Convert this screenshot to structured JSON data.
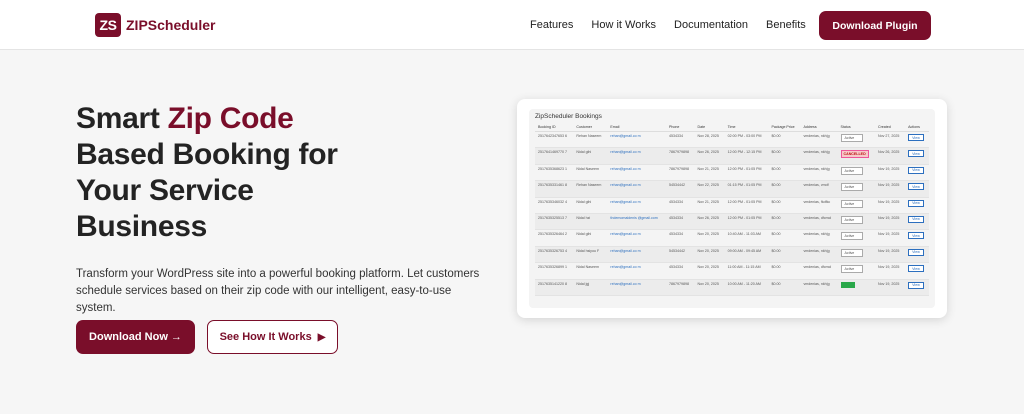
{
  "header": {
    "logo_mark": "ZS",
    "logo_text": "ZIPScheduler",
    "nav": [
      "Features",
      "How it Works",
      "Documentation",
      "Benefits"
    ],
    "cta": "Download Plugin"
  },
  "hero": {
    "title_l1a": "Smart ",
    "title_l1b": "Zip Code",
    "title_l2": "Based Booking for",
    "title_l3": "Your Service",
    "title_l4": "Business",
    "description": "Transform your WordPress site into a powerful booking platform. Let customers schedule services based on their zip code with our intelligent, easy-to-use system.",
    "btn_primary": "Download Now →",
    "btn_secondary": "See How It Works",
    "btn_secondary_icon": "▶"
  },
  "bookings": {
    "title": "ZipScheduler Bookings",
    "columns": [
      "Booking ID",
      "Customer",
      "Email",
      "Phone",
      "Date",
      "Time",
      "Package Price",
      "Address",
      "Status",
      "Created",
      "Actions"
    ],
    "rows": [
      [
        "2517642347653 6",
        "Rehan Naseem",
        "rehan@gmail.co m",
        "4534334",
        "Nov 28, 2025",
        "02:00 PM - 03:00 PM",
        "$0.00",
        "vmdenias, nkh|g",
        "Active",
        "Nov 27, 2025",
        "View"
      ],
      [
        "2517641469770 7",
        "Nidal gihi",
        "rehan@gmail.co m",
        "7867979898",
        "Nov 26, 2025",
        "12:00 PM - 12:15 PM",
        "$0.00",
        "vmdenias, nkh|g",
        "CANCELLED",
        "Nov 26, 2025",
        "View"
      ],
      [
        "2517635368623 1",
        "Nidal Naseem",
        "rehan@gmail.co m",
        "7867979898",
        "Nov 21, 2025",
        "12:00 PM - 01:05 PM",
        "$0.00",
        "vmdenias, nkh|g",
        "Active",
        "Nov 19, 2025",
        "View"
      ],
      [
        "2517635331461 8",
        "Rehan Naseem",
        "rehan@gmail.co m",
        "54534442",
        "Nov 22, 2025",
        "01:15 PM - 01:05 PM",
        "$0.00",
        "vmdenias, vmdf",
        "Active",
        "Nov 19, 2025",
        "View"
      ],
      [
        "2517635346032 4",
        "Nidal gihi",
        "rehan@gmail.co m",
        "4534334",
        "Nov 21, 2025",
        "12:00 PM - 01:05 PM",
        "$0.00",
        "vmdenias, fkdfkc",
        "Active",
        "Nov 19, 2025",
        "View"
      ],
      [
        "2517635325513 7",
        "Nidal hzi",
        "thdemomaidenis @gmail.com",
        "4534334",
        "Nov 26, 2025",
        "12:00 PM - 01:05 PM",
        "$0.00",
        "vmdenias, dfcmcl",
        "Active",
        "Nov 19, 2025",
        "View"
      ],
      [
        "2517635326464 2",
        "Nidal gihi",
        "rehan@gmail.co m",
        "4534334",
        "Nov 20, 2025",
        "10:40 AM - 11:03 AM",
        "$0.00",
        "vmdenias, nkh|g",
        "Active",
        "Nov 19, 2025",
        "View"
      ],
      [
        "2517635326753 4",
        "Nidal hsiyou F",
        "rehan@gmail.co m",
        "54534442",
        "Nov 20, 2025",
        "09:00 AM - 09:45 AM",
        "$0.00",
        "vmdenias, nkh|g",
        "Active",
        "Nov 19, 2025",
        "View"
      ],
      [
        "2517635326899 1",
        "Nidal Naseem",
        "rehan@gmail.co m",
        "4534334",
        "Nov 20, 2025",
        "11:00 AM - 11:15 AM",
        "$0.00",
        "vmdenias, dfcmcl",
        "Active",
        "Nov 19, 2025",
        "View"
      ],
      [
        "2517635141220 8",
        "Nidal jgj",
        "rehan@gmail.co m",
        "7867979898",
        "Nov 20, 2025",
        "10:00 AM - 11:20 AM",
        "$0.00",
        "vmdenias, nkh|g",
        "",
        "Nov 19, 2025",
        "View"
      ]
    ]
  },
  "colors": {
    "brand": "#7a0e2a",
    "link": "#2c6fbf",
    "success": "#2aa84a",
    "danger_bg": "#f7c9c9"
  }
}
